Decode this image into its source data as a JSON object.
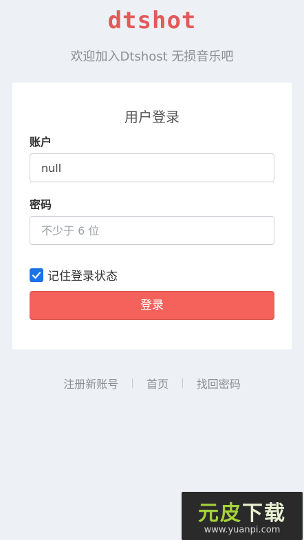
{
  "header": {
    "logo_text": "dtshot",
    "tagline": "欢迎加入Dtshost 无损音乐吧"
  },
  "login_card": {
    "title": "用户登录",
    "account_label": "账户",
    "account_value": "null",
    "password_label": "密码",
    "password_placeholder": "不少于 6 位",
    "remember_label": "记住登录状态",
    "remember_checked": true,
    "submit_label": "登录"
  },
  "footer": {
    "links": [
      "注册新账号",
      "首页",
      "找回密码"
    ],
    "separator": "|"
  },
  "watermark": {
    "title_part1": "元皮",
    "title_part2": "下载",
    "url": "www.yuanpi.com"
  },
  "colors": {
    "brand_red": "#e25a5a",
    "button_red": "#f4625b",
    "checkbox_blue": "#1a73e8",
    "background": "#edf1f5"
  }
}
